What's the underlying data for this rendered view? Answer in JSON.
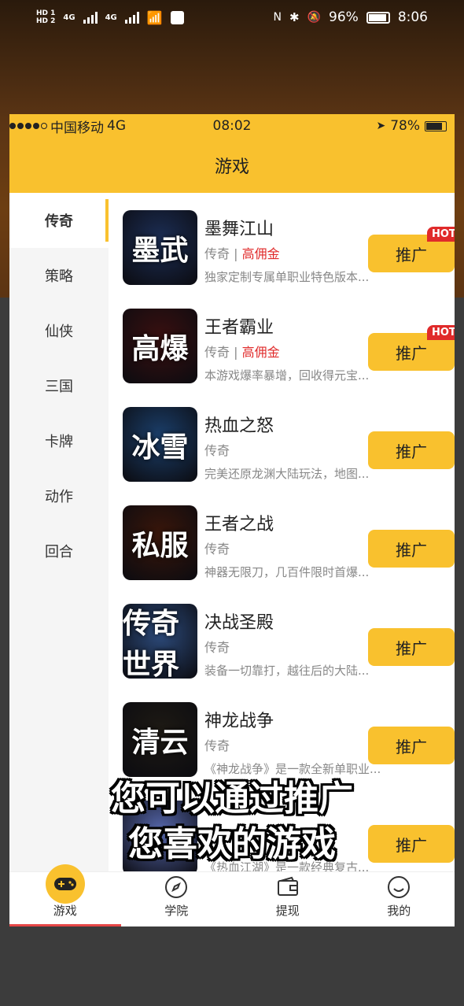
{
  "android_status": {
    "left": "HD1 HD2 4G 4G",
    "battery": "96%",
    "time": "8:06"
  },
  "ios_status": {
    "carrier": "中国移动",
    "network": "4G",
    "time": "08:02",
    "battery": "78%"
  },
  "header": {
    "title": "游戏"
  },
  "sidebar": {
    "items": [
      {
        "label": "传奇"
      },
      {
        "label": "策略"
      },
      {
        "label": "仙侠"
      },
      {
        "label": "三国"
      },
      {
        "label": "卡牌"
      },
      {
        "label": "动作"
      },
      {
        "label": "回合"
      }
    ]
  },
  "games": [
    {
      "name": "墨舞江山",
      "tag": "传奇",
      "extra": "高佣金",
      "desc": "独家定制专属单职业特色版本...",
      "button": "推广",
      "hot": "HOT",
      "thumb_text": "墨武",
      "color": "#1c2e55"
    },
    {
      "name": "王者霸业",
      "tag": "传奇",
      "extra": "高佣金",
      "desc": "本游戏爆率暴增，回收得元宝...",
      "button": "推广",
      "hot": "HOT",
      "thumb_text": "高爆",
      "color": "#3a1010"
    },
    {
      "name": "热血之怒",
      "tag": "传奇",
      "extra": "",
      "desc": "完美还原龙渊大陆玩法，地图...",
      "button": "推广",
      "hot": "",
      "thumb_text": "冰雪",
      "color": "#1b3f6b"
    },
    {
      "name": "王者之战",
      "tag": "传奇",
      "extra": "",
      "desc": "神器无限刀，几百件限时首爆...",
      "button": "推广",
      "hot": "",
      "thumb_text": "私服",
      "color": "#3a160a"
    },
    {
      "name": "决战圣殿",
      "tag": "传奇",
      "extra": "",
      "desc": "装备一切靠打，越往后的大陆...",
      "button": "推广",
      "hot": "",
      "thumb_text": "传奇世界",
      "color": "#2c4a7a"
    },
    {
      "name": "神龙战争",
      "tag": "传奇",
      "extra": "",
      "desc": "《神龙战争》是一款全新单职业...",
      "button": "推广",
      "hot": "",
      "thumb_text": "清云",
      "color": "#1e1a14"
    },
    {
      "name": "",
      "tag": "",
      "extra": "",
      "desc": "《热血江湖》是一款经典复古...",
      "button": "推广",
      "hot": "",
      "thumb_text": "",
      "color": "#5566aa"
    }
  ],
  "tabbar": [
    {
      "label": "游戏",
      "icon": "gamepad-icon"
    },
    {
      "label": "学院",
      "icon": "compass-icon"
    },
    {
      "label": "提现",
      "icon": "wallet-icon"
    },
    {
      "label": "我的",
      "icon": "smile-icon"
    }
  ],
  "subtitles": [
    "您可以通过推广",
    "您喜欢的游戏"
  ]
}
